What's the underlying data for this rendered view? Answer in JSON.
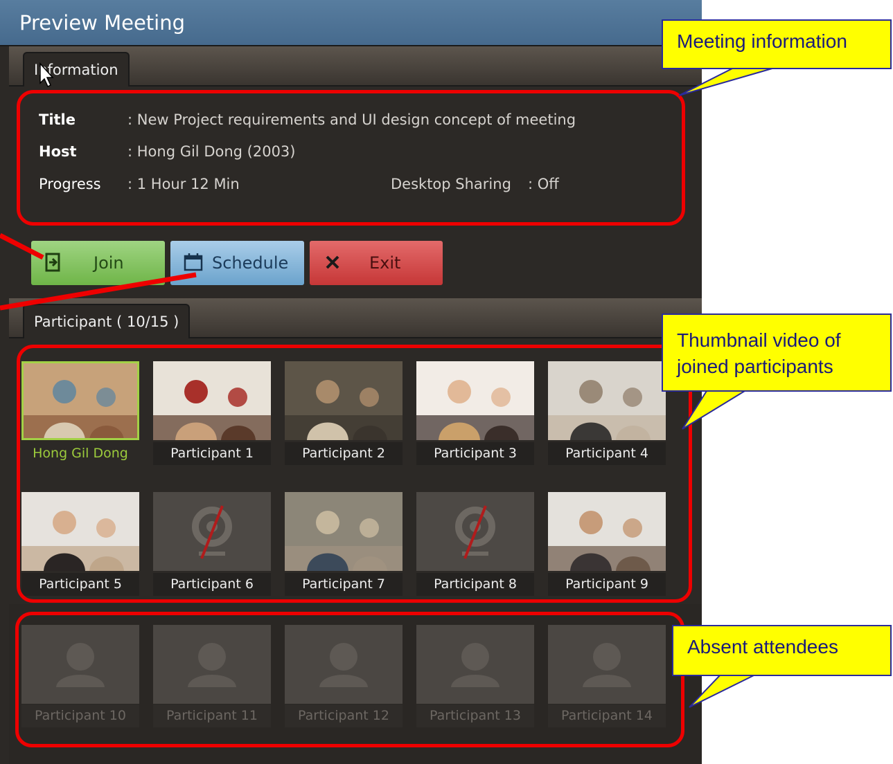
{
  "window": {
    "title": "Preview Meeting"
  },
  "info_tab": {
    "label": "Information"
  },
  "meeting": {
    "title_label": "Title",
    "title_value": ": New Project requirements and UI design concept of meeting",
    "host_label": "Host",
    "host_value": ": Hong Gil Dong (2003)",
    "progress_label": "Progress",
    "progress_value": ": 1 Hour 12 Min",
    "sharing_label": "Desktop Sharing",
    "sharing_value": ": Off"
  },
  "buttons": {
    "join": "Join",
    "schedule": "Schedule",
    "exit": "Exit"
  },
  "participant_tab": {
    "label": "Participant ( 10/15 )"
  },
  "joined": [
    {
      "name": "Hong Gil Dong",
      "video": "office-group-photo",
      "self": true
    },
    {
      "name": "Participant 1",
      "video": "two-people-laughing-photo"
    },
    {
      "name": "Participant 2",
      "video": "man-on-phone-photo"
    },
    {
      "name": "Participant 3",
      "video": "smiling-woman-photo"
    },
    {
      "name": "Participant 4",
      "video": "meeting-table-photo"
    },
    {
      "name": "Participant 5",
      "video": "businesswoman-photo"
    },
    {
      "name": "Participant 6",
      "video": "camera-off-icon"
    },
    {
      "name": "Participant 7",
      "video": "team-meeting-photo"
    },
    {
      "name": "Participant 8",
      "video": "camera-off-icon"
    },
    {
      "name": "Participant 9",
      "video": "businessman-photo"
    }
  ],
  "absent": [
    {
      "name": "Participant 10",
      "icon": "person-silhouette-icon"
    },
    {
      "name": "Participant 11",
      "icon": "person-silhouette-icon"
    },
    {
      "name": "Participant 12",
      "icon": "person-silhouette-icon"
    },
    {
      "name": "Participant 13",
      "icon": "person-silhouette-icon"
    },
    {
      "name": "Participant 14",
      "icon": "person-silhouette-icon"
    }
  ],
  "callouts": {
    "meeting_info": "Meeting information",
    "thumbnails_line1": "Thumbnail video of",
    "thumbnails_line2": "joined participants",
    "absent": "Absent attendees"
  },
  "colors": {
    "annotation_red": "#ee0000",
    "callout_yellow": "#ffff00",
    "self_highlight": "#9ccb3c",
    "join_green": "#7fc45a",
    "schedule_blue": "#86b8dc",
    "exit_red": "#d44a4a"
  }
}
